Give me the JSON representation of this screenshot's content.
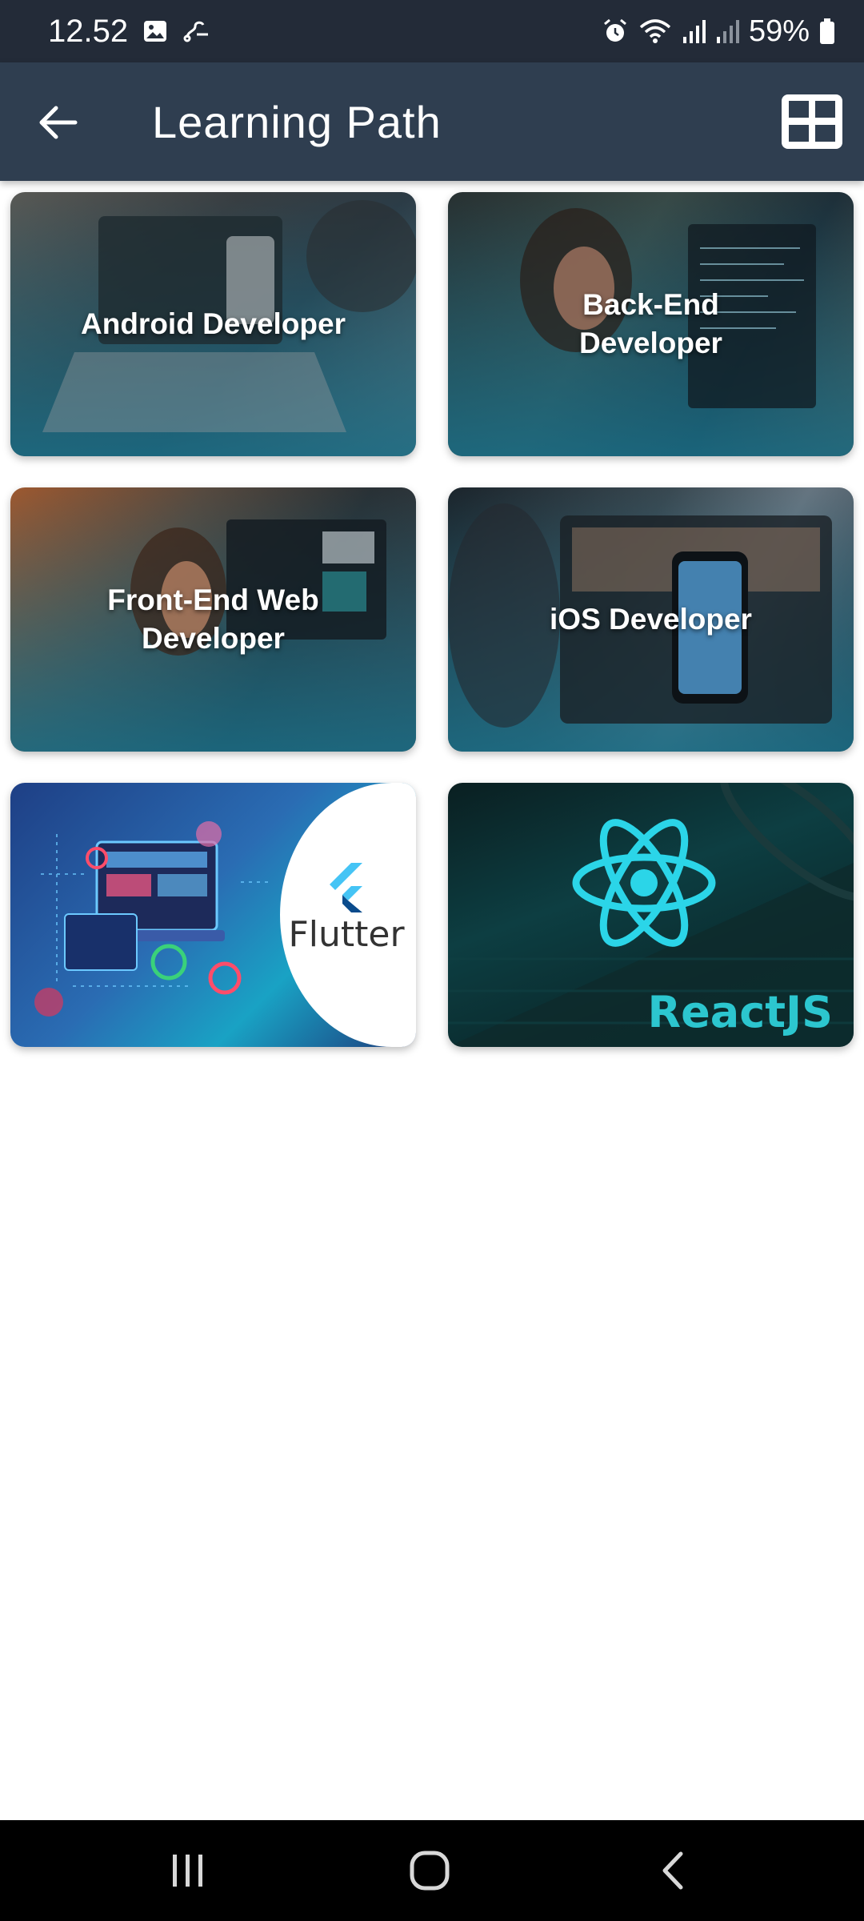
{
  "status_bar": {
    "time": "12.52",
    "battery": "59%",
    "icons_left": [
      "gallery-icon",
      "link-icon"
    ],
    "icons_right": [
      "alarm-icon",
      "wifi-icon",
      "signal-icon",
      "signal-icon-2",
      "battery-icon"
    ]
  },
  "app_bar": {
    "title": "Learning Path",
    "back_icon": "arrow-left-icon",
    "view_icon": "grid-view-icon"
  },
  "cards": [
    {
      "label": "Android Developer"
    },
    {
      "label": "Back-End Developer"
    },
    {
      "label": "Front-End Web Developer"
    },
    {
      "label": "iOS Developer"
    },
    {
      "label": "Flutter"
    },
    {
      "label": "ReactJS"
    }
  ],
  "nav_bar": {
    "items": [
      "recents-icon",
      "home-icon",
      "back-icon"
    ]
  },
  "colors": {
    "status_bar": "#232b38",
    "app_bar": "#2f3e50",
    "card_overlay": "#196e87",
    "react_accent": "#2cc6cf"
  }
}
